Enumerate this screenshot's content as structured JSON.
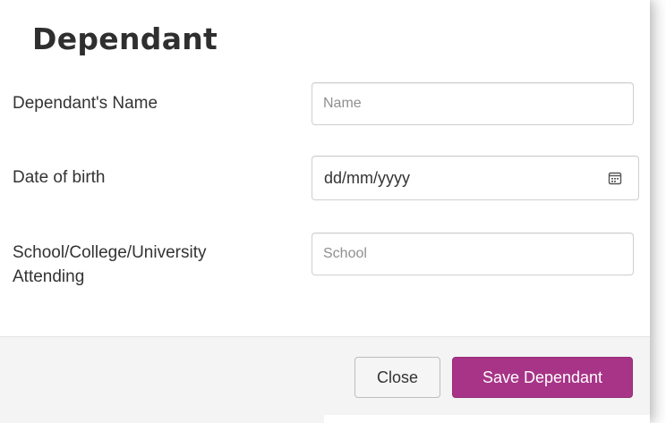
{
  "dialog": {
    "title": "Dependant"
  },
  "form": {
    "name_label": "Dependant's Name",
    "name_placeholder": "Name",
    "name_value": "",
    "dob_label": "Date of birth",
    "dob_value": "dd/mm/yyyy",
    "school_label": "School/College/University Attending",
    "school_placeholder": "School",
    "school_value": ""
  },
  "footer": {
    "close_label": "Close",
    "save_label": "Save Dependant"
  },
  "icons": {
    "date_picker": "calendar-icon"
  },
  "colors": {
    "primary_button": "#a73487",
    "footer_background": "#f4f4f4",
    "title_text": "#2f2f2f"
  }
}
